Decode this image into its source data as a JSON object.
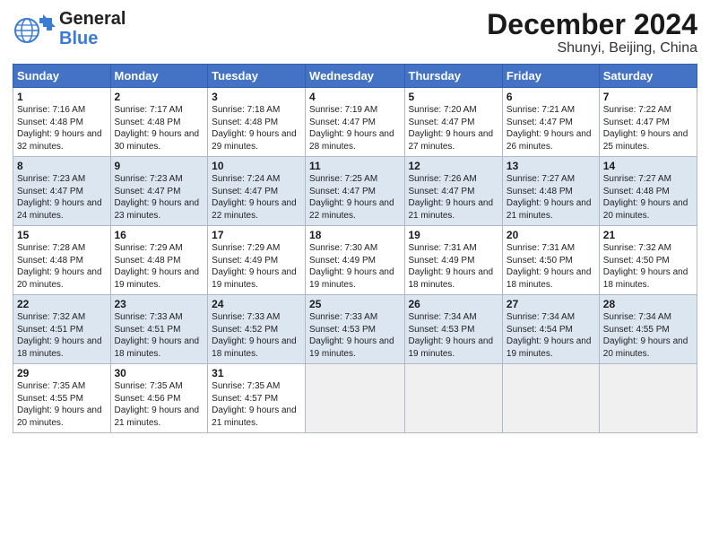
{
  "header": {
    "logo_general": "General",
    "logo_blue": "Blue",
    "title": "December 2024",
    "subtitle": "Shunyi, Beijing, China"
  },
  "calendar": {
    "weekdays": [
      "Sunday",
      "Monday",
      "Tuesday",
      "Wednesday",
      "Thursday",
      "Friday",
      "Saturday"
    ],
    "weeks": [
      [
        {
          "day": "1",
          "sunrise": "7:16 AM",
          "sunset": "4:48 PM",
          "daylight": "9 hours and 32 minutes."
        },
        {
          "day": "2",
          "sunrise": "7:17 AM",
          "sunset": "4:48 PM",
          "daylight": "9 hours and 30 minutes."
        },
        {
          "day": "3",
          "sunrise": "7:18 AM",
          "sunset": "4:48 PM",
          "daylight": "9 hours and 29 minutes."
        },
        {
          "day": "4",
          "sunrise": "7:19 AM",
          "sunset": "4:47 PM",
          "daylight": "9 hours and 28 minutes."
        },
        {
          "day": "5",
          "sunrise": "7:20 AM",
          "sunset": "4:47 PM",
          "daylight": "9 hours and 27 minutes."
        },
        {
          "day": "6",
          "sunrise": "7:21 AM",
          "sunset": "4:47 PM",
          "daylight": "9 hours and 26 minutes."
        },
        {
          "day": "7",
          "sunrise": "7:22 AM",
          "sunset": "4:47 PM",
          "daylight": "9 hours and 25 minutes."
        }
      ],
      [
        {
          "day": "8",
          "sunrise": "7:23 AM",
          "sunset": "4:47 PM",
          "daylight": "9 hours and 24 minutes."
        },
        {
          "day": "9",
          "sunrise": "7:23 AM",
          "sunset": "4:47 PM",
          "daylight": "9 hours and 23 minutes."
        },
        {
          "day": "10",
          "sunrise": "7:24 AM",
          "sunset": "4:47 PM",
          "daylight": "9 hours and 22 minutes."
        },
        {
          "day": "11",
          "sunrise": "7:25 AM",
          "sunset": "4:47 PM",
          "daylight": "9 hours and 22 minutes."
        },
        {
          "day": "12",
          "sunrise": "7:26 AM",
          "sunset": "4:47 PM",
          "daylight": "9 hours and 21 minutes."
        },
        {
          "day": "13",
          "sunrise": "7:27 AM",
          "sunset": "4:48 PM",
          "daylight": "9 hours and 21 minutes."
        },
        {
          "day": "14",
          "sunrise": "7:27 AM",
          "sunset": "4:48 PM",
          "daylight": "9 hours and 20 minutes."
        }
      ],
      [
        {
          "day": "15",
          "sunrise": "7:28 AM",
          "sunset": "4:48 PM",
          "daylight": "9 hours and 20 minutes."
        },
        {
          "day": "16",
          "sunrise": "7:29 AM",
          "sunset": "4:48 PM",
          "daylight": "9 hours and 19 minutes."
        },
        {
          "day": "17",
          "sunrise": "7:29 AM",
          "sunset": "4:49 PM",
          "daylight": "9 hours and 19 minutes."
        },
        {
          "day": "18",
          "sunrise": "7:30 AM",
          "sunset": "4:49 PM",
          "daylight": "9 hours and 19 minutes."
        },
        {
          "day": "19",
          "sunrise": "7:31 AM",
          "sunset": "4:49 PM",
          "daylight": "9 hours and 18 minutes."
        },
        {
          "day": "20",
          "sunrise": "7:31 AM",
          "sunset": "4:50 PM",
          "daylight": "9 hours and 18 minutes."
        },
        {
          "day": "21",
          "sunrise": "7:32 AM",
          "sunset": "4:50 PM",
          "daylight": "9 hours and 18 minutes."
        }
      ],
      [
        {
          "day": "22",
          "sunrise": "7:32 AM",
          "sunset": "4:51 PM",
          "daylight": "9 hours and 18 minutes."
        },
        {
          "day": "23",
          "sunrise": "7:33 AM",
          "sunset": "4:51 PM",
          "daylight": "9 hours and 18 minutes."
        },
        {
          "day": "24",
          "sunrise": "7:33 AM",
          "sunset": "4:52 PM",
          "daylight": "9 hours and 18 minutes."
        },
        {
          "day": "25",
          "sunrise": "7:33 AM",
          "sunset": "4:53 PM",
          "daylight": "9 hours and 19 minutes."
        },
        {
          "day": "26",
          "sunrise": "7:34 AM",
          "sunset": "4:53 PM",
          "daylight": "9 hours and 19 minutes."
        },
        {
          "day": "27",
          "sunrise": "7:34 AM",
          "sunset": "4:54 PM",
          "daylight": "9 hours and 19 minutes."
        },
        {
          "day": "28",
          "sunrise": "7:34 AM",
          "sunset": "4:55 PM",
          "daylight": "9 hours and 20 minutes."
        }
      ],
      [
        {
          "day": "29",
          "sunrise": "7:35 AM",
          "sunset": "4:55 PM",
          "daylight": "9 hours and 20 minutes."
        },
        {
          "day": "30",
          "sunrise": "7:35 AM",
          "sunset": "4:56 PM",
          "daylight": "9 hours and 21 minutes."
        },
        {
          "day": "31",
          "sunrise": "7:35 AM",
          "sunset": "4:57 PM",
          "daylight": "9 hours and 21 minutes."
        },
        null,
        null,
        null,
        null
      ]
    ]
  }
}
